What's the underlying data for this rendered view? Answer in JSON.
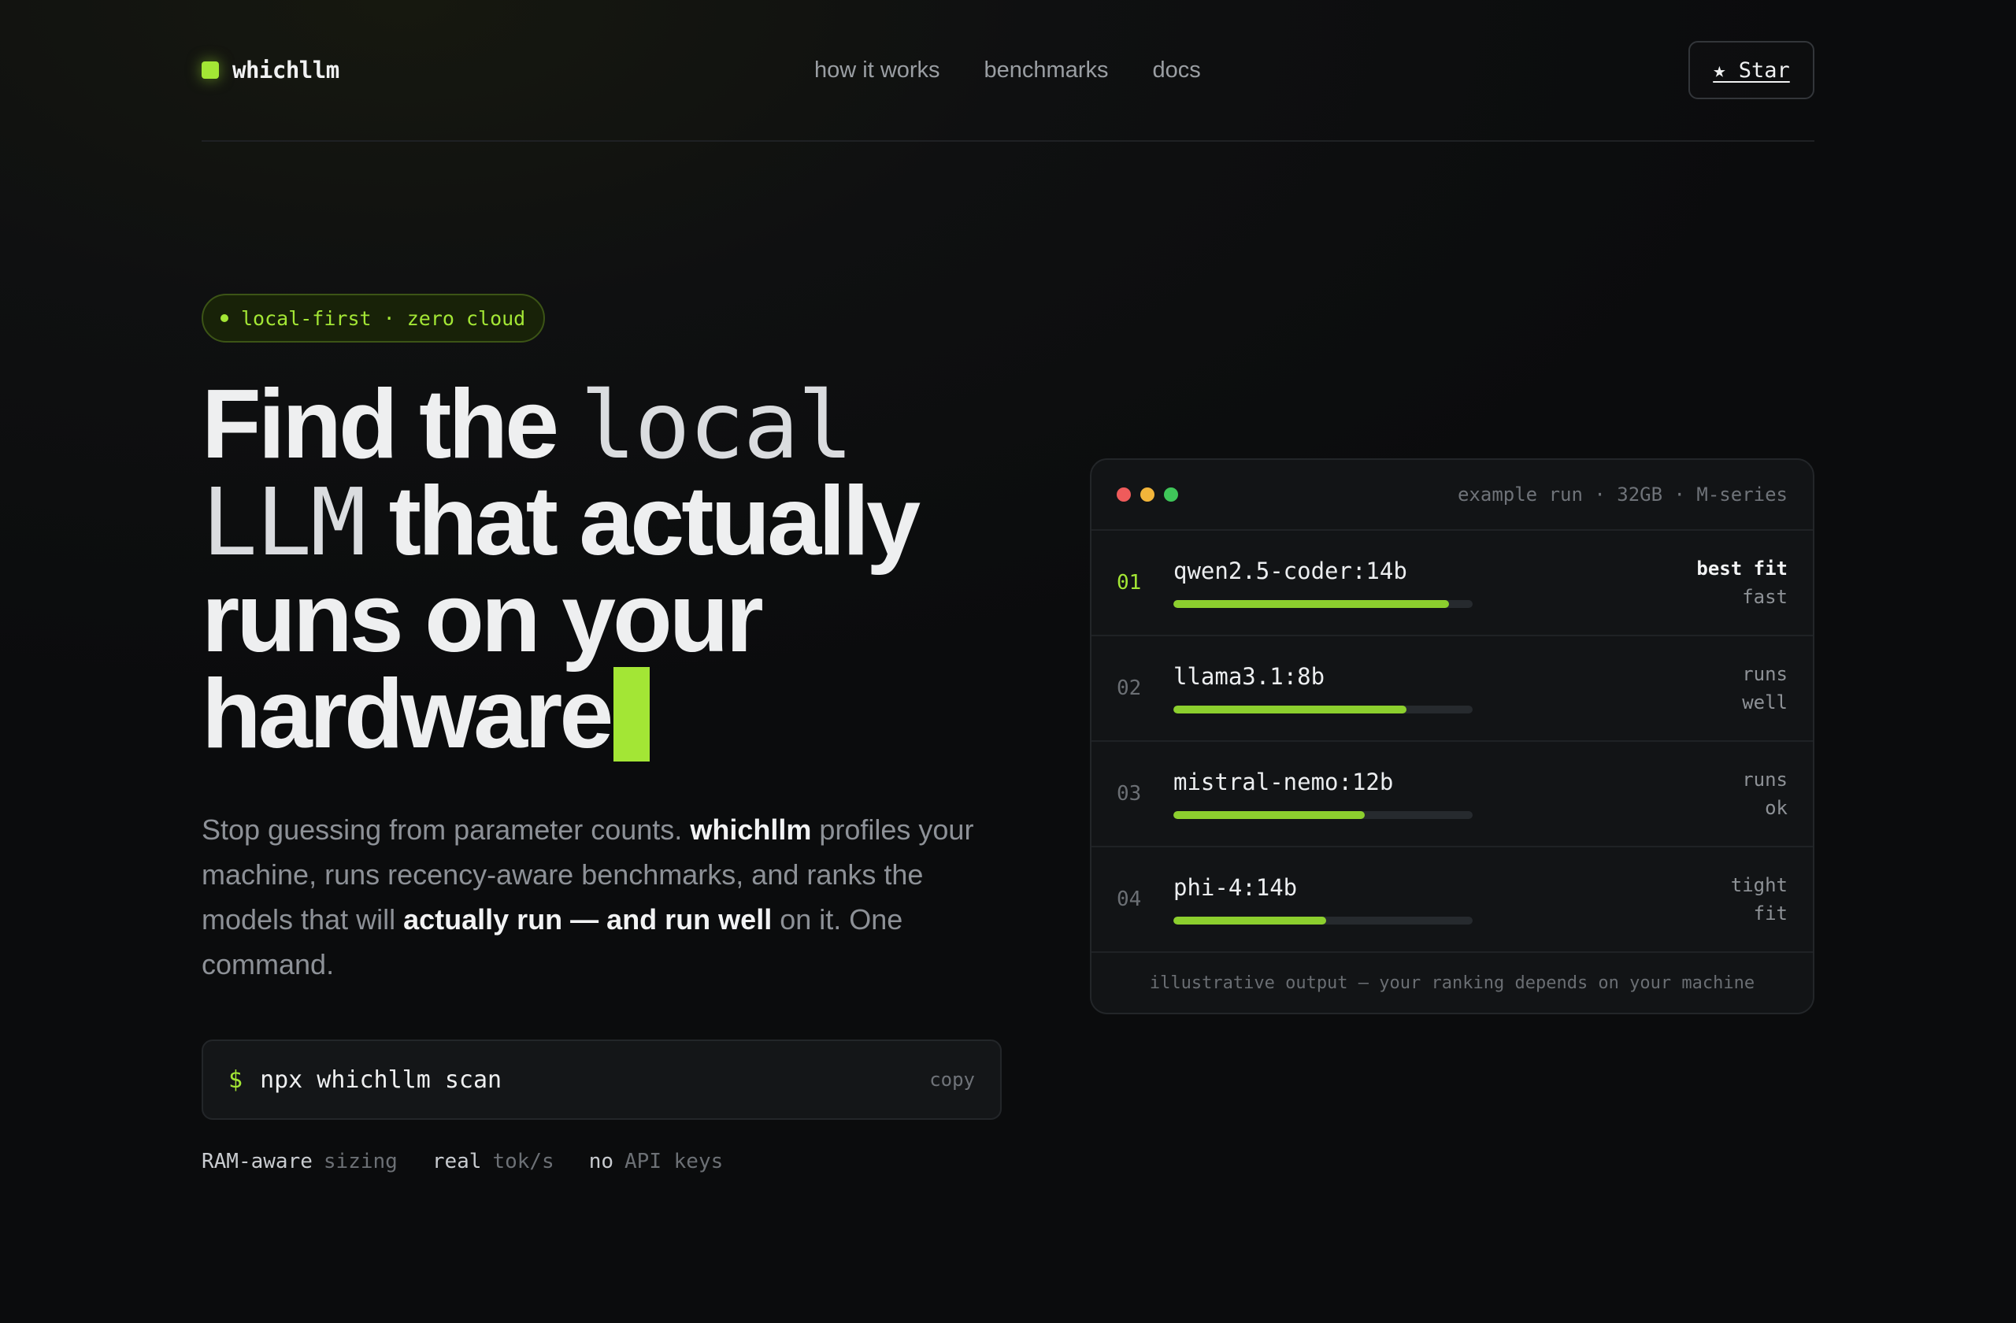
{
  "nav": {
    "brand": "whichllm",
    "links": [
      "how it works",
      "benchmarks",
      "docs"
    ],
    "star_label": "★ Star"
  },
  "hero": {
    "pill": "local-first · zero cloud",
    "headline": {
      "w1": "Find the",
      "w2": "local",
      "w3": "LLM",
      "w4": "that actually",
      "w5": "runs on your",
      "w6": "hardware"
    },
    "lede": {
      "p1": "Stop guessing from parameter counts. ",
      "b1": "whichllm",
      "p2": " profiles your machine, runs recency-aware benchmarks, and ranks the models that will ",
      "b2": "actually run — and run well",
      "p3": " on it. One command."
    },
    "command": {
      "prompt": "$",
      "text": "npx whichllm scan",
      "copy_label": "copy"
    },
    "features": [
      {
        "key": "RAM-aware",
        "value": "sizing"
      },
      {
        "key": "real",
        "value": "tok/s"
      },
      {
        "key": "no",
        "value": "API keys"
      }
    ]
  },
  "terminal": {
    "meta": "example run · 32GB · M-series",
    "dot_colors": [
      "#ef5b5b",
      "#f2b53a",
      "#3fc659"
    ],
    "rows": [
      {
        "num": "01",
        "name": "qwen2.5-coder:14b",
        "score": 0.92,
        "tag1": "best fit",
        "tag2": "fast"
      },
      {
        "num": "02",
        "name": "llama3.1:8b",
        "score": 0.78,
        "tag1": "runs",
        "tag2": "well"
      },
      {
        "num": "03",
        "name": "mistral-nemo:12b",
        "score": 0.64,
        "tag1": "runs",
        "tag2": "ok"
      },
      {
        "num": "04",
        "name": "phi-4:14b",
        "score": 0.51,
        "tag1": "tight",
        "tag2": "fit"
      }
    ],
    "footer": "illustrative output — your ranking depends on your machine"
  },
  "colors": {
    "accent": "#a3e635",
    "background": "#0d0e0f"
  }
}
